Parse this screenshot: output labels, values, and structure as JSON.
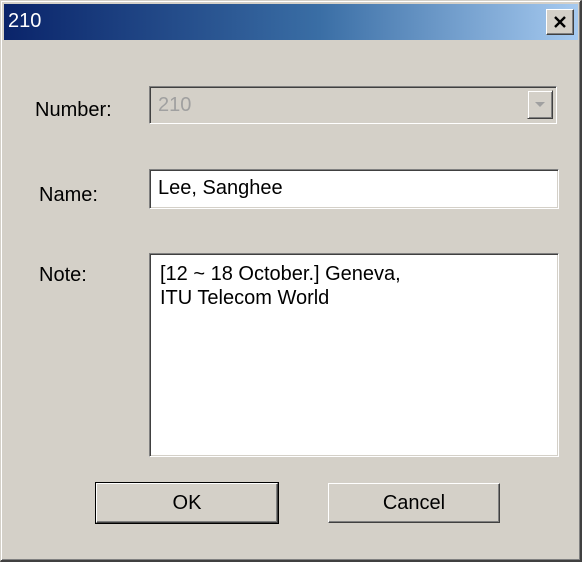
{
  "window": {
    "title": "210",
    "close_symbol": "×"
  },
  "fields": {
    "number": {
      "label": "Number:",
      "value": "210",
      "disabled": true
    },
    "name": {
      "label": "Name:",
      "value": "Lee, Sanghee"
    },
    "note": {
      "label": "Note:",
      "line1": "[12 ~ 18 October.] Geneva,",
      "line2": "ITU Telecom World"
    }
  },
  "buttons": {
    "ok_label": "OK",
    "cancel_label": "Cancel"
  },
  "colors": {
    "title_gradient_start": "#0a246a",
    "title_gradient_end": "#a6caf0",
    "dialog_face": "#d4d0c8",
    "disabled_text": "#a0a0a0"
  }
}
